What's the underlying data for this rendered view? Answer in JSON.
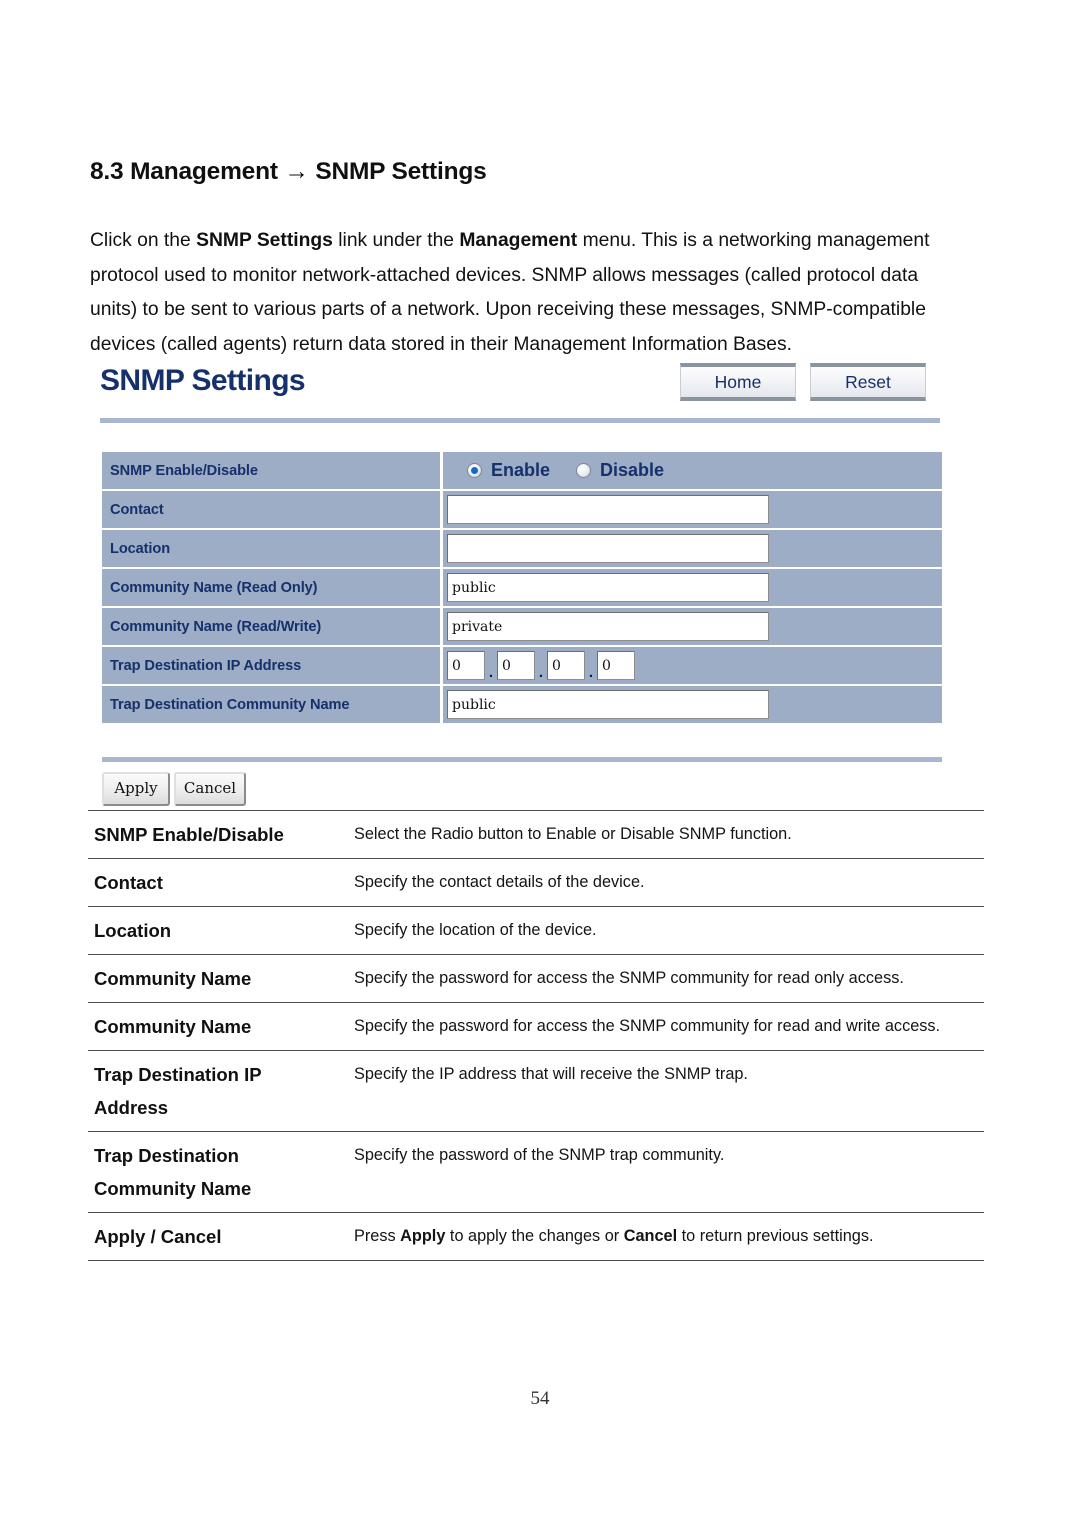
{
  "document": {
    "heading": "8.3 Management → SNMP Settings",
    "paragraph_parts": [
      {
        "text": "Click on the ",
        "bold": false
      },
      {
        "text": "SNMP Settings",
        "bold": true
      },
      {
        "text": " link under the ",
        "bold": false
      },
      {
        "text": "Management",
        "bold": true
      },
      {
        "text": " menu. This is a networking management protocol used to monitor network-attached devices. SNMP allows messages (called protocol data units) to be sent to various parts of a network. Upon receiving these messages, SNMP-compatible devices (called agents) return data stored in their Management Information Bases.",
        "bold": false
      }
    ],
    "page_number": "54"
  },
  "ui": {
    "title": "SNMP Settings",
    "home_button": "Home",
    "reset_button": "Reset",
    "apply_button": "Apply",
    "cancel_button": "Cancel",
    "colors": {
      "title_navy": "#16306b",
      "row_bg": "#9dadc6",
      "rule": "#a9b6cf",
      "radio_dot": "#1667c8"
    },
    "rows": {
      "snmp_enable_label": "SNMP Enable/Disable",
      "enable_label": "Enable",
      "disable_label": "Disable",
      "enable_selected": true,
      "contact_label": "Contact",
      "contact_value": "",
      "location_label": "Location",
      "location_value": "",
      "community_ro_label": "Community Name (Read Only)",
      "community_ro_value": "public",
      "community_rw_label": "Community Name (Read/Write)",
      "community_rw_value": "private",
      "trap_ip_label": "Trap Destination IP Address",
      "trap_ip_octets": [
        "0",
        "0",
        "0",
        "0"
      ],
      "trap_community_label": "Trap Destination Community Name",
      "trap_community_value": "public"
    }
  },
  "descriptions": [
    {
      "term_lines": [
        "SNMP Enable/Disable"
      ],
      "desc_parts": [
        {
          "text": "Select the Radio button to Enable or Disable SNMP function.",
          "bold": false
        }
      ]
    },
    {
      "term_lines": [
        "Contact"
      ],
      "desc_parts": [
        {
          "text": "Specify the contact details of the device.",
          "bold": false
        }
      ]
    },
    {
      "term_lines": [
        "Location"
      ],
      "desc_parts": [
        {
          "text": "Specify the location of the device.",
          "bold": false
        }
      ]
    },
    {
      "term_lines": [
        "Community Name"
      ],
      "desc_parts": [
        {
          "text": "Specify the password for access the SNMP community for read only access.",
          "bold": false
        }
      ]
    },
    {
      "term_lines": [
        "Community Name"
      ],
      "desc_parts": [
        {
          "text": "Specify the password for access the SNMP community for read and write access.",
          "bold": false
        }
      ]
    },
    {
      "term_lines": [
        "Trap Destination IP",
        "Address"
      ],
      "desc_parts": [
        {
          "text": "Specify the IP address that will receive the SNMP trap.",
          "bold": false
        }
      ]
    },
    {
      "term_lines": [
        "Trap Destination",
        "Community Name"
      ],
      "desc_parts": [
        {
          "text": "Specify the password of the SNMP trap community.",
          "bold": false
        }
      ]
    },
    {
      "term_lines": [
        "Apply / Cancel"
      ],
      "desc_parts": [
        {
          "text": "Press ",
          "bold": false
        },
        {
          "text": "Apply",
          "bold": true
        },
        {
          "text": " to apply the changes or ",
          "bold": false
        },
        {
          "text": "Cancel",
          "bold": true
        },
        {
          "text": " to return previous settings.",
          "bold": false
        }
      ]
    }
  ]
}
